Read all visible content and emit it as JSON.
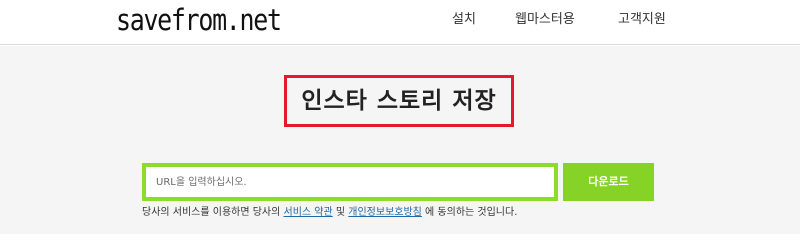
{
  "header": {
    "logo_text": "savefrom.net",
    "nav": {
      "install": "설치",
      "webmaster": "웹마스터용",
      "support": "고객지원"
    }
  },
  "main": {
    "title": "인스타 스토리 저장",
    "url_placeholder": "URL을 입력하십시오.",
    "download_label": "다운로드",
    "terms": {
      "prefix": "당사의 서비스를 이용하면 당사의 ",
      "terms_link": "서비스 약관",
      "and": " 및 ",
      "privacy_link": "개인정보보호방침",
      "suffix": " 에 동의하는 것입니다."
    }
  },
  "colors": {
    "title_border": "#e11b2d",
    "input_border": "#8edb2b",
    "download_button": "#86d226",
    "link": "#1f6aa6",
    "background": "#f5f5f5"
  }
}
